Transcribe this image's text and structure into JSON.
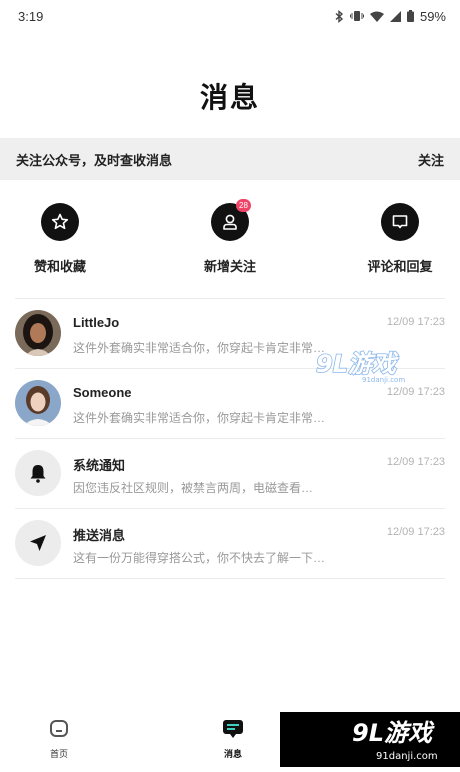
{
  "status_bar": {
    "time": "3:19",
    "battery": "59%"
  },
  "title": "消息",
  "banner": {
    "text": "关注公众号，及时查收消息",
    "action": "关注"
  },
  "quick_actions": [
    {
      "label": "赞和收藏",
      "icon": "star-icon"
    },
    {
      "label": "新增关注",
      "icon": "person-icon",
      "badge": "28"
    },
    {
      "label": "评论和回复",
      "icon": "comment-icon"
    }
  ],
  "messages": [
    {
      "name": "LittleJo",
      "preview": "这件外套确实非常适合你，你穿起卡肯定非常…",
      "time": "12/09 17:23",
      "avatar": "user-photo"
    },
    {
      "name": "Someone",
      "preview": "这件外套确实非常适合你，你穿起卡肯定非常…",
      "time": "12/09 17:23",
      "avatar": "user-photo"
    },
    {
      "name": "系统通知",
      "preview": "因您违反社区规则，被禁言两周，电磁查看…",
      "time": "12/09 17:23",
      "avatar": "bell-icon"
    },
    {
      "name": "推送消息",
      "preview": "这有一份万能得穿搭公式，你不快去了解一下…",
      "time": "12/09 17:23",
      "avatar": "send-icon"
    }
  ],
  "bottom_nav": [
    {
      "label": "首页",
      "icon": "home-icon"
    },
    {
      "label": "消息",
      "icon": "message-icon"
    }
  ],
  "watermark": {
    "logo": "9L游戏",
    "domain": "91danji.com"
  },
  "colors": {
    "badge": "#f04467",
    "banner_bg": "#efefef",
    "icon_bg": "#111111"
  }
}
